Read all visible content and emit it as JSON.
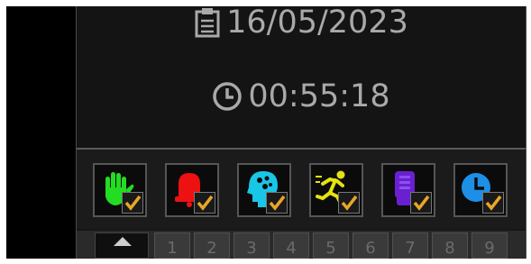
{
  "header": {
    "date_icon": "clipboard-icon",
    "date": "16/05/2023",
    "time_icon": "clock-icon",
    "time": "00:55:18"
  },
  "status_tiles": [
    {
      "name": "hand-alarm",
      "icon": "hand-icon",
      "color": "#22dd22",
      "checked": true
    },
    {
      "name": "bell-alarm",
      "icon": "bell-icon",
      "color": "#ee1111",
      "checked": true
    },
    {
      "name": "head-alarm",
      "icon": "head-icon",
      "color": "#19c6e6",
      "checked": true
    },
    {
      "name": "fall-alarm",
      "icon": "running-person-icon",
      "color": "#e6e20f",
      "checked": true
    },
    {
      "name": "device-alarm",
      "icon": "device-icon",
      "color": "#6a1fd1",
      "checked": true
    },
    {
      "name": "timer-alarm",
      "icon": "clock-icon",
      "color": "#1e8fe6",
      "checked": true
    }
  ],
  "pagination": {
    "home_icon": "home-icon",
    "pages": [
      "1",
      "2",
      "3",
      "4",
      "5",
      "6",
      "7",
      "8",
      "9"
    ]
  },
  "colors": {
    "check": "#e8a628",
    "text": "#a9a9a9",
    "panel": "#161616"
  }
}
